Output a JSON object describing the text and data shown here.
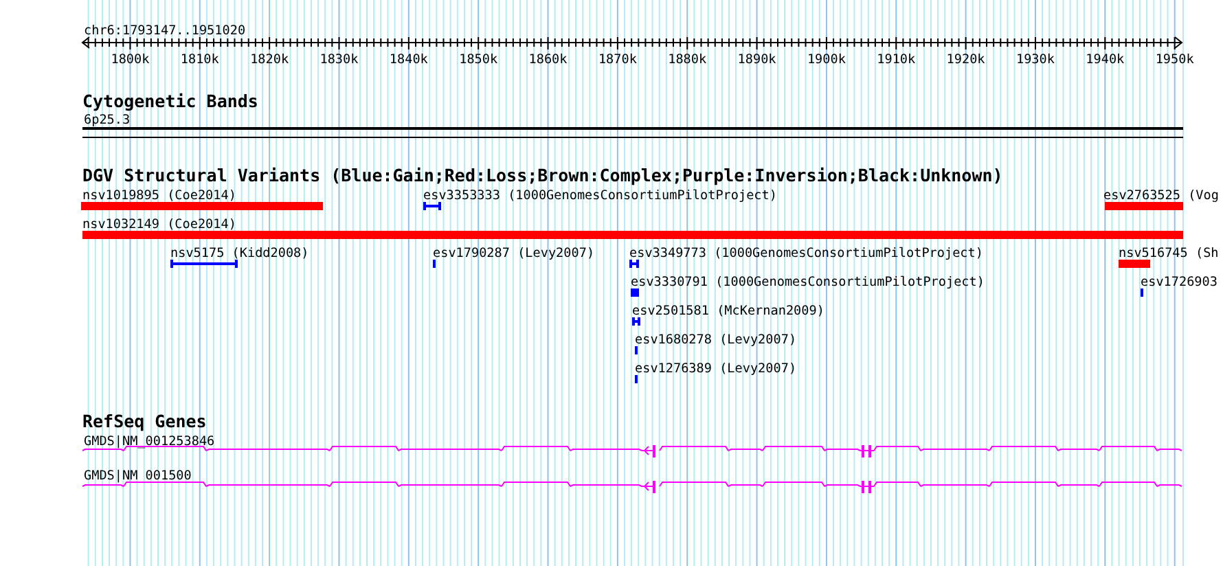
{
  "ruler": {
    "label": "chr6:1793147..1951020",
    "ticks": [
      "1800k",
      "1810k",
      "1820k",
      "1830k",
      "1840k",
      "1850k",
      "1860k",
      "1870k",
      "1880k",
      "1890k",
      "1900k",
      "1910k",
      "1920k",
      "1930k",
      "1940k",
      "1950k"
    ]
  },
  "tracks": [
    {
      "kind": "bands",
      "title": "Cytogenetic Bands",
      "features": [
        {
          "label": "6p25.3"
        }
      ]
    },
    {
      "kind": "variants",
      "title": "DGV Structural Variants (Blue:Gain;Red:Loss;Brown:Complex;Purple:Inversion;Black:Unknown)",
      "features": [
        {
          "label": "nsv1019895 (Coe2014)",
          "color": "#ff0000"
        },
        {
          "label": "esv3353333 (1000GenomesConsortiumPilotProject)",
          "color": "#0000ff"
        },
        {
          "label": "esv2763525 (Vog",
          "color": "#ff0000"
        },
        {
          "label": "nsv1032149 (Coe2014)",
          "color": "#ff0000"
        },
        {
          "label": "nsv5175 (Kidd2008)",
          "color": "#0000ff"
        },
        {
          "label": "esv1790287 (Levy2007)",
          "color": "#0000ff"
        },
        {
          "label": "esv3349773 (1000GenomesConsortiumPilotProject)",
          "color": "#0000ff"
        },
        {
          "label": "nsv516745 (Sh",
          "color": "#ff0000"
        },
        {
          "label": "esv3330791 (1000GenomesConsortiumPilotProject)",
          "color": "#0000ff"
        },
        {
          "label": "esv1726903",
          "color": "#0000ff"
        },
        {
          "label": "esv2501581 (McKernan2009)",
          "color": "#0000ff"
        },
        {
          "label": "esv1680278 (Levy2007)",
          "color": "#0000ff"
        },
        {
          "label": "esv1276389 (Levy2007)",
          "color": "#0000ff"
        }
      ]
    },
    {
      "kind": "genes",
      "title": "RefSeq Genes",
      "features": [
        {
          "label": "GMDS|NM_001253846"
        },
        {
          "label": "GMDS|NM_001500"
        }
      ]
    }
  ]
}
